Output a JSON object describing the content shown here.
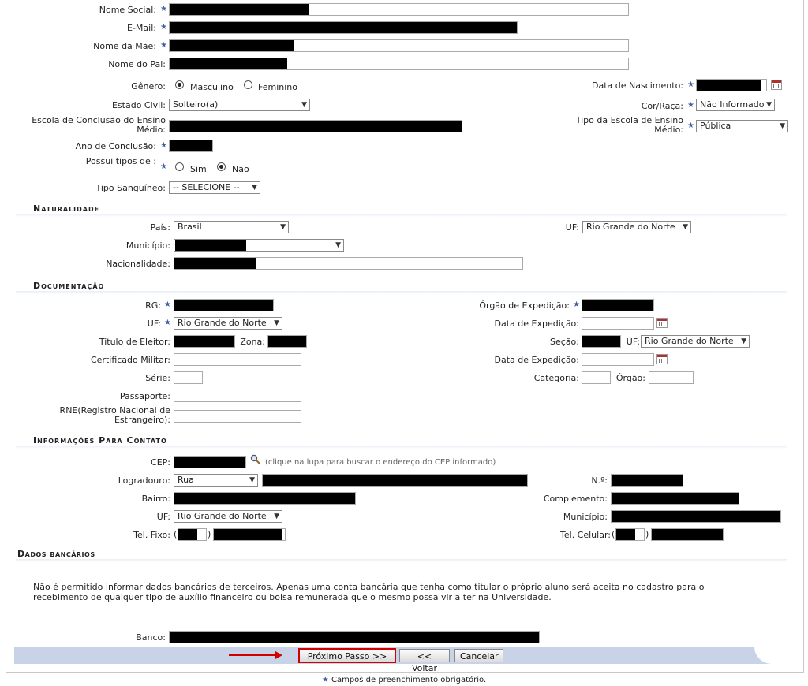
{
  "personal": {
    "nome_social": "Nome Social:",
    "email": "E-Mail:",
    "nome_mae": "Nome da Mãe:",
    "nome_pai": "Nome do Pai:",
    "genero": "Gênero:",
    "masculino": "Masculino",
    "feminino": "Feminino",
    "data_nascimento": "Data de Nascimento:",
    "estado_civil": "Estado Civil:",
    "estado_civil_value": "Solteiro(a)",
    "cor_raca": "Cor/Raça:",
    "cor_raca_value": "Não Informado",
    "escola_conclusao": "Escola de Conclusão do Ensino Médio:",
    "tipo_escola": "Tipo da Escola de Ensino Médio:",
    "tipo_escola_value": "Pública",
    "ano_conclusao": "Ano de Conclusão:",
    "possui_tipos": "Possui tipos de :",
    "sim": "Sim",
    "nao": "Não",
    "tipo_sanguineo": "Tipo Sanguíneo:",
    "tipo_sanguineo_value": "-- SELECIONE --"
  },
  "naturalidade": {
    "title": "Naturalidade",
    "pais": "País:",
    "pais_value": "Brasil",
    "uf": "UF:",
    "uf_value": "Rio Grande do Norte",
    "municipio": "Município:",
    "nacionalidade": "Nacionalidade:"
  },
  "documentacao": {
    "title": "Documentação",
    "rg": "RG:",
    "orgao_expedicao": "Órgão de Expedição:",
    "uf": "UF:",
    "uf_value": "Rio Grande do Norte",
    "data_expedicao": "Data de Expedição:",
    "titulo_eleitor": "Titulo de Eleitor:",
    "zona": "Zona:",
    "secao": "Seção:",
    "uf2": "UF:",
    "uf2_value": "Rio Grande do Norte",
    "certificado_militar": "Certificado Militar:",
    "data_expedicao2": "Data de Expedição:",
    "serie": "Série:",
    "categoria": "Categoria:",
    "orgao": "Órgão:",
    "passaporte": "Passaporte:",
    "rne": "RNE(Registro Nacional de Estrangeiro):"
  },
  "contato": {
    "title": "Informações Para Contato",
    "cep": "CEP:",
    "cep_hint": "(clique na lupa para buscar o endereço do CEP informado)",
    "logradouro": "Logradouro:",
    "logradouro_value": "Rua",
    "numero": "N.º:",
    "bairro": "Bairro:",
    "complemento": "Complemento:",
    "uf": "UF:",
    "uf_value": "Rio Grande do Norte",
    "municipio": "Município:",
    "tel_fixo": "Tel. Fixo:",
    "tel_celular": "Tel. Celular:",
    "paren_open": "(",
    "paren_close": ")"
  },
  "bancarios": {
    "title": "Dados bancários",
    "notice": "Não é permitido informar dados bancários de terceiros. Apenas uma conta bancária que tenha como titular o próprio aluno será aceita no cadastro para o recebimento de qualquer tipo de auxílio financeiro ou bolsa remunerada que o mesmo possa vir a ter na Universidade.",
    "banco": "Banco:"
  },
  "buttons": {
    "proximo": "Próximo Passo >>",
    "voltar": "<< Voltar",
    "cancelar": "Cancelar"
  },
  "footnote": {
    "star": "★",
    "text": "Campos de preenchimento obrigatório."
  },
  "icons": {
    "required": "star-icon",
    "calendar": "calendar-icon",
    "search": "magnifier-icon",
    "dropdown": "chevron-down-icon"
  }
}
